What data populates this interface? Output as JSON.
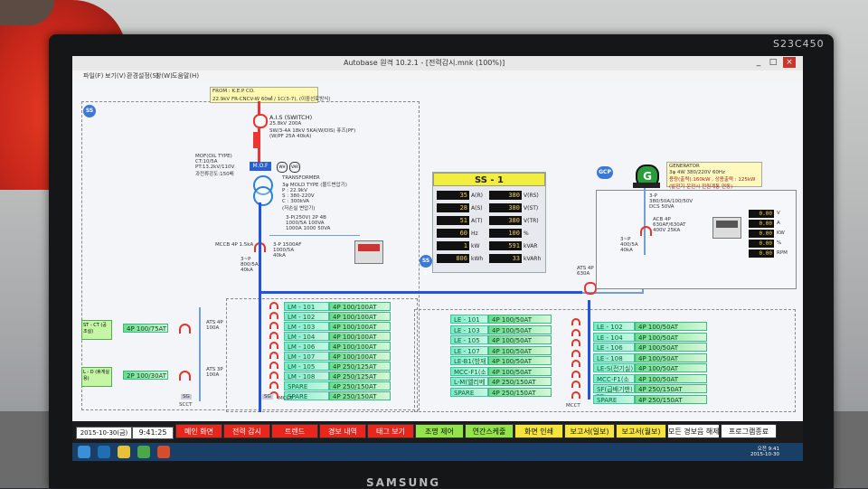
{
  "monitor": {
    "brand_top": "S23C450",
    "brand_bottom": "SAMSUNG"
  },
  "window": {
    "title": "Autobase 원격 10.2.1 - [전력감시.mnk (100%)]",
    "buttons": [
      "_",
      "□",
      "×"
    ]
  },
  "menu": [
    "파일(F)",
    "보기(V)",
    "환경설정(S)",
    "창(W)",
    "도움말(H)"
  ],
  "diagram": {
    "source_box": [
      "FROM : K.E.P CO.",
      "22.9kV FR-CNCV-W 60㎟ / 1C(3-7), (이중선로방식)"
    ],
    "zone_labels": [
      "SS",
      "SS 2",
      "GCP"
    ],
    "ais": [
      "A.I.S (SWITCH)",
      "25.8kV 200A",
      "SW/3-4A 18kV 5KA(W/DIS) 퓨즈(PF)",
      "(W/PF 25A 40kA)"
    ],
    "mof": {
      "label": "M.O.F",
      "meters": [
        "WH",
        "VAR"
      ]
    },
    "mof_note": [
      "MOF(OIL TYPE)",
      "CT:10/5A",
      "PT:13.2kV/110V",
      "과전류강도:150배"
    ],
    "transformer": [
      "TRANSFORMER",
      "3φ MOLD TYPE (몰드변압기)",
      "P : 22.9kV",
      "S : 380-220V",
      "C : 300kVA",
      "(저손실 변압기)"
    ],
    "acb": [
      "3-P 1500AF",
      "1000/5A",
      "40kA"
    ],
    "tr_caption": [
      "3-P(250V) 2P 4B",
      "1000/5A 100VA",
      "1000A 1000 50VA"
    ],
    "mccb_left": "MCCB 4P 1.5kA",
    "acb_left": [
      "3~P",
      "800/5A",
      "40kA"
    ],
    "ats_left": [
      "ATS 4P",
      "100A"
    ],
    "ats_left2": [
      "ATS 3P",
      "100A"
    ],
    "left_feeders": [
      {
        "name": "ST - CT (공조실)",
        "spec": "4P 100/75AT"
      },
      {
        "name": "L - D (휴게실용)",
        "spec": "2P 100/30AT"
      }
    ],
    "lm_rows": [
      {
        "name": "LM - 101",
        "spec": "4P 100/100AT"
      },
      {
        "name": "LM - 102",
        "spec": "4P 100/100AT"
      },
      {
        "name": "LM - 103",
        "spec": "4P 100/100AT"
      },
      {
        "name": "LM - 104",
        "spec": "4P 100/100AT"
      },
      {
        "name": "LM - 106",
        "spec": "4P 100/100AT"
      },
      {
        "name": "LM - 107",
        "spec": "4P 100/100AT"
      },
      {
        "name": "LM - 105",
        "spec": "4P 250/125AT"
      },
      {
        "name": "LM - 108",
        "spec": "4P 250/125AT"
      },
      {
        "name": "SPARE",
        "spec": "4P 250/150AT"
      },
      {
        "name": "SPARE",
        "spec": "4P 250/150AT"
      }
    ],
    "le_rows": [
      {
        "name": "LE - 101",
        "spec": "4P 100/50AT"
      },
      {
        "name": "LE - 103",
        "spec": "4P 100/50AT"
      },
      {
        "name": "LE - 105",
        "spec": "4P 100/50AT"
      },
      {
        "name": "LE - 107",
        "spec": "4P 100/50AT"
      },
      {
        "name": "LE-B1(방재실)",
        "spec": "4P 100/50AT"
      },
      {
        "name": "MCC-F1(소방)",
        "spec": "4P 100/50AT"
      },
      {
        "name": "L-M(엘리베이터)",
        "spec": "4P 250/150AT"
      },
      {
        "name": "SPARE",
        "spec": "4P 250/150AT"
      }
    ],
    "le_rows_right": [
      {
        "name": "LE - 102",
        "spec": "4P 100/50AT"
      },
      {
        "name": "LE - 104",
        "spec": "4P 100/50AT"
      },
      {
        "name": "LE - 106",
        "spec": "4P 100/50AT"
      },
      {
        "name": "LE - 108",
        "spec": "4P 100/50AT"
      },
      {
        "name": "LE-S(전기실)",
        "spec": "4P 100/50AT"
      },
      {
        "name": "MCC-F1(소방,동력)",
        "spec": "4P 100/50AT"
      },
      {
        "name": "SF(급배기팬)",
        "spec": "4P 250/150AT"
      },
      {
        "name": "SPARE",
        "spec": "4P 250/150AT"
      }
    ],
    "bus_tags": [
      "SG",
      "SCCT",
      "SG",
      "MCCT",
      "SG",
      "MCCT"
    ],
    "ats_right": [
      "ATS 4P",
      "630A"
    ],
    "generator": {
      "letter": "G",
      "note": [
        "GENERATOR",
        "3φ 4W 380/220V 60Hz",
        "용량(출력):160kW , 상용출력 : 125kW",
        "(발전기 운전시 전원계통 연동)"
      ],
      "acb": [
        "3-P",
        "380/50A/100/50V",
        "DCS 50VA"
      ],
      "acb2": [
        "ACB 4P",
        "630AF/630AT",
        "400V 25KA"
      ],
      "ct": [
        "3~P",
        "400/5A",
        "40kA"
      ]
    }
  },
  "ss_panel": {
    "title": "SS - 1",
    "rows": [
      {
        "v1": "35",
        "u1": "A(R)",
        "v2": "380",
        "u2": "V(RS)"
      },
      {
        "v1": "28",
        "u1": "A(S)",
        "v2": "380",
        "u2": "V(ST)"
      },
      {
        "v1": "51",
        "u1": "A(T)",
        "v2": "380",
        "u2": "V(TR)"
      },
      {
        "v1": "60",
        "u1": "Hz",
        "v2": "100",
        "u2": "%"
      },
      {
        "v1": "1",
        "u1": "kW",
        "v2": "591",
        "u2": "kVAR"
      },
      {
        "v1": "806",
        "u1": "kWh",
        "v2": "33",
        "u2": "kVARh"
      }
    ]
  },
  "gen_meter": [
    {
      "val": "0.00",
      "unit": "V"
    },
    {
      "val": "0.00",
      "unit": "A"
    },
    {
      "val": "0.00",
      "unit": "KW"
    },
    {
      "val": "0.00",
      "unit": "%"
    },
    {
      "val": "0.00",
      "unit": "RPM"
    }
  ],
  "toolbar": {
    "date": "2015-10-30(금)",
    "time": "9:41:25",
    "buttons": [
      {
        "label": "메인 화면",
        "style": "red"
      },
      {
        "label": "전력 감시",
        "style": "red"
      },
      {
        "label": "트렌드",
        "style": "red"
      },
      {
        "label": "경보 내역",
        "style": "red"
      },
      {
        "label": "태그 보기",
        "style": "red"
      },
      {
        "label": "조명 제어",
        "style": "green"
      },
      {
        "label": "연간스케줄",
        "style": "green"
      },
      {
        "label": "화면 인쇄",
        "style": "yellow"
      },
      {
        "label": "보고서(일보)",
        "style": "yellow"
      },
      {
        "label": "보고서(월보)",
        "style": "yellow"
      },
      {
        "label": "모든 경보음 해제",
        "style": "white"
      },
      {
        "label": "프로그램종료",
        "style": "white"
      }
    ]
  },
  "taskbar": {
    "clock_time": "오전 9:41",
    "clock_date": "2015-10-30"
  }
}
